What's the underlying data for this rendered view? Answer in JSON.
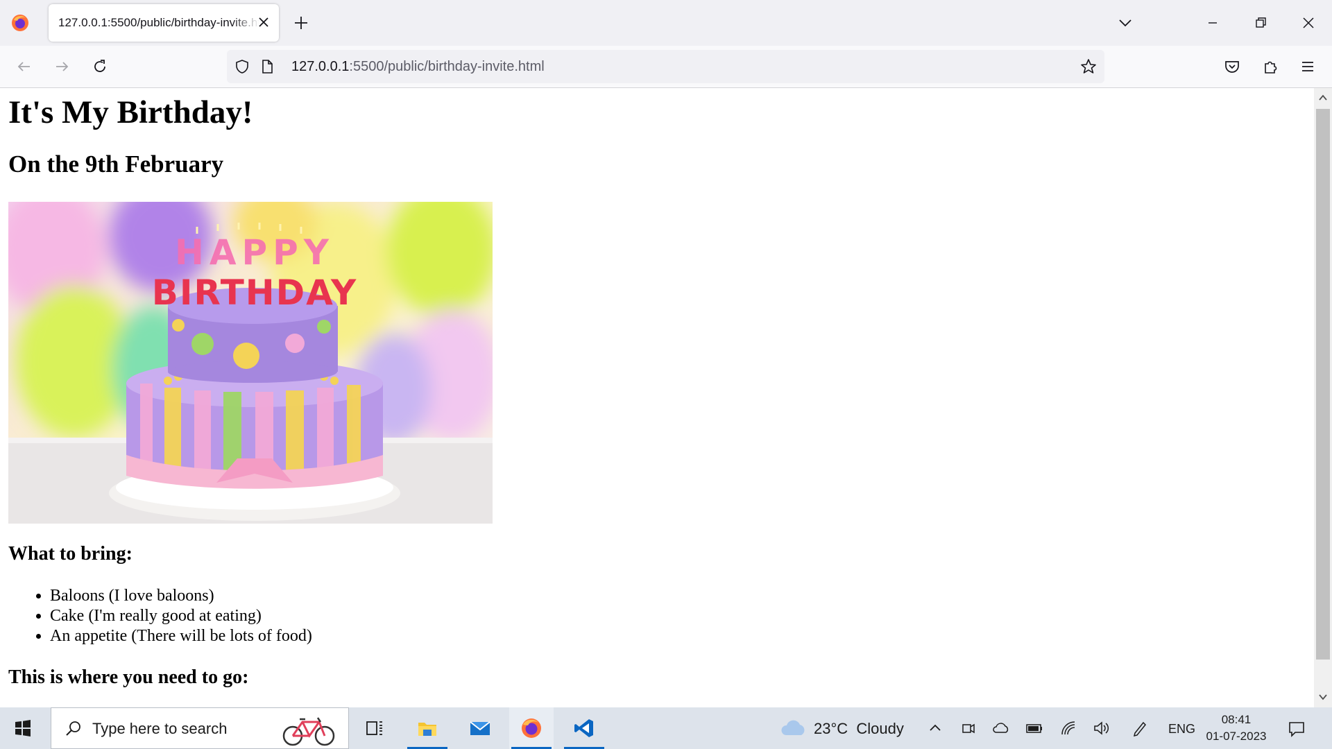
{
  "browser": {
    "tab": {
      "title": "127.0.0.1:5500/public/birthday-invite.html"
    },
    "url": {
      "host": "127.0.0.1",
      "rest": ":5500/public/birthday-invite.html"
    }
  },
  "page": {
    "heading": "It's My Birthday!",
    "subheading": "On the 9th February",
    "image": {
      "candles_line1": "HAPPY",
      "candles_line2": "BIRTHDAY"
    },
    "bring_title": "What to bring:",
    "bring_items": [
      "Baloons (I love baloons)",
      "Cake (I'm really good at eating)",
      "An appetite (There will be lots of food)"
    ],
    "where_title": "This is where you need to go:"
  },
  "taskbar": {
    "search_placeholder": "Type here to search",
    "weather": {
      "temp": "23°C",
      "condition": "Cloudy"
    },
    "language": "ENG",
    "time": "08:41",
    "date": "01-07-2023",
    "apps": [
      "task-view",
      "file-explorer",
      "mail",
      "firefox",
      "vscode"
    ]
  },
  "colors": {
    "accent": "#0a66c2",
    "taskbar_bg": "#dde3eb",
    "tab_bar_bg": "#f0f0f4"
  }
}
